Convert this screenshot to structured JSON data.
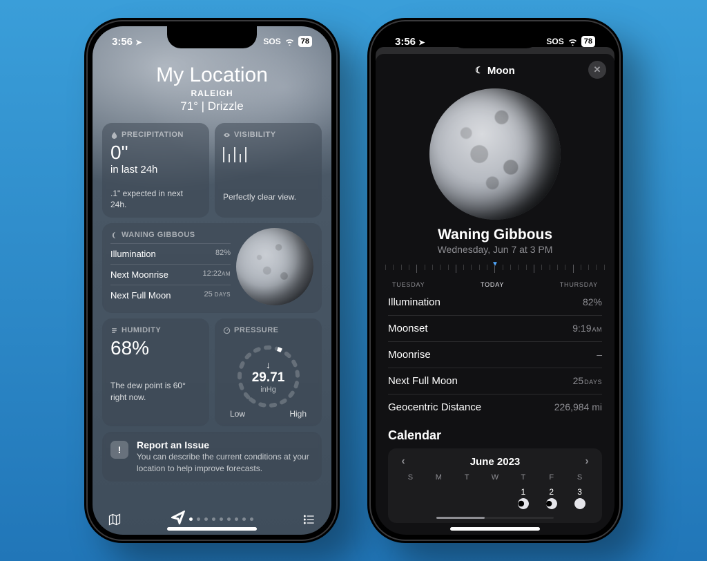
{
  "statusbar": {
    "time": "3:56",
    "sos": "SOS",
    "battery": "78"
  },
  "left": {
    "title": "My Location",
    "city": "RALEIGH",
    "temp_cond": "71°  |  Drizzle",
    "precip": {
      "head": "PRECIPITATION",
      "value": "0\"",
      "period": "in last 24h",
      "note": ".1\" expected in next 24h."
    },
    "visibility": {
      "head": "VISIBILITY",
      "note": "Perfectly clear view."
    },
    "moon": {
      "head": "WANING GIBBOUS",
      "illum_label": "Illumination",
      "illum_val": "82%",
      "rise_label": "Next Moonrise",
      "rise_val": "12:22",
      "rise_unit": "AM",
      "full_label": "Next Full Moon",
      "full_val": "25",
      "full_unit": "DAYS"
    },
    "humidity": {
      "head": "HUMIDITY",
      "value": "68%",
      "note": "The dew point is 60° right now."
    },
    "pressure": {
      "head": "PRESSURE",
      "value": "29.71",
      "unit": "inHg",
      "low": "Low",
      "high": "High"
    },
    "report": {
      "title": "Report an Issue",
      "sub": "You can describe the current conditions at your location to help improve forecasts."
    }
  },
  "right": {
    "sheet_title": "Moon",
    "phase": "Waning Gibbous",
    "datetime": "Wednesday, Jun 7 at 3 PM",
    "timeline": {
      "l": "TUESDAY",
      "c": "TODAY",
      "r": "THURSDAY"
    },
    "details": {
      "illum_l": "Illumination",
      "illum_v": "82%",
      "set_l": "Moonset",
      "set_v": "9:19",
      "set_u": "AM",
      "rise_l": "Moonrise",
      "rise_v": "–",
      "full_l": "Next Full Moon",
      "full_v": "25",
      "full_u": "DAYS",
      "dist_l": "Geocentric Distance",
      "dist_v": "226,984 mi"
    },
    "calendar": {
      "section": "Calendar",
      "month": "June 2023",
      "dows": [
        "S",
        "M",
        "T",
        "W",
        "T",
        "F",
        "S"
      ],
      "days": [
        {
          "n": "",
          "p": ""
        },
        {
          "n": "",
          "p": ""
        },
        {
          "n": "",
          "p": ""
        },
        {
          "n": "",
          "p": ""
        },
        {
          "n": "1",
          "p": "cp-94"
        },
        {
          "n": "2",
          "p": "cp-90"
        },
        {
          "n": "3",
          "p": "cp-99"
        }
      ]
    }
  }
}
